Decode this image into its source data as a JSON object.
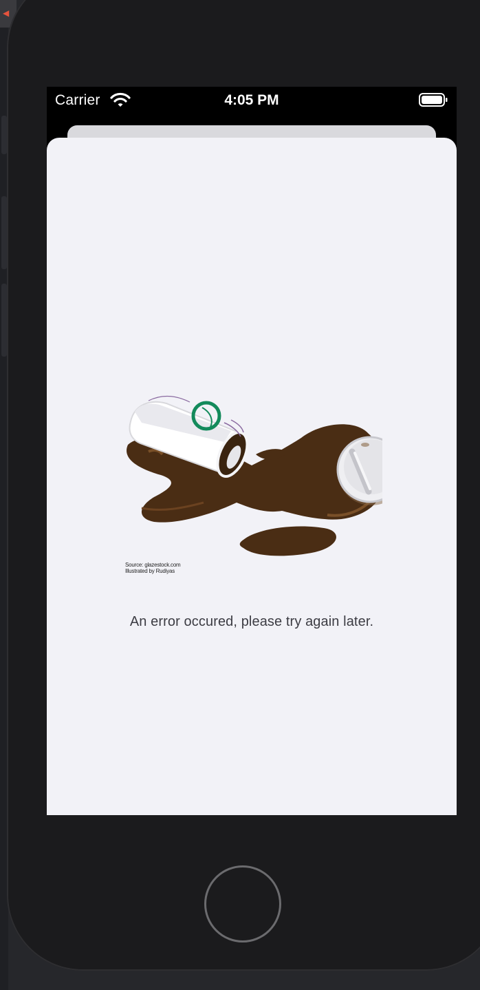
{
  "status_bar": {
    "carrier": "Carrier",
    "time": "4:05 PM",
    "wifi_icon": "wifi-icon",
    "battery_icon": "battery-icon"
  },
  "error_view": {
    "image_credit_source": "Source: glazestock.com",
    "image_credit_author": "Illustrated by Rudiyas",
    "message": "An error occured, please try again later."
  },
  "colors": {
    "coffee": "#4a2d14",
    "cup_ring": "#138a5b",
    "sheet_background": "#f2f2f7",
    "device_frame": "#1b1b1d"
  },
  "device": {
    "home_button_icon": "home-button"
  }
}
